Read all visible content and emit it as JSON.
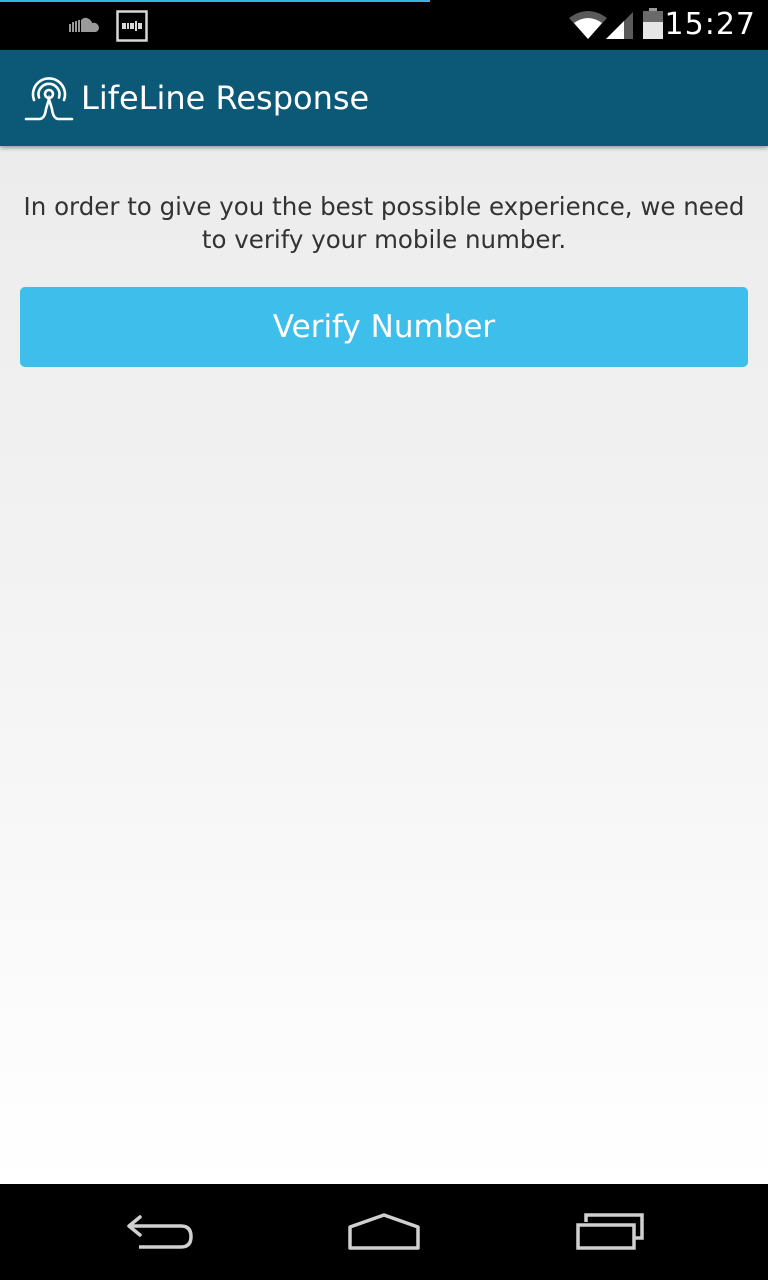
{
  "status_bar": {
    "time": "15:27",
    "icons": [
      "soundcloud-icon",
      "media-notification-icon",
      "wifi-icon",
      "signal-icon",
      "battery-icon"
    ]
  },
  "action_bar": {
    "title": "LifeLine Response",
    "logo": "lifeline-logo-icon",
    "background_color": "#0c5877"
  },
  "main": {
    "intro_text": "In order to give you the best possible experience, we need to verify your mobile number.",
    "verify_button_label": "Verify Number",
    "button_color": "#3ebfeb"
  },
  "nav_bar": {
    "buttons": [
      "back-icon",
      "home-icon",
      "recent-apps-icon"
    ]
  }
}
